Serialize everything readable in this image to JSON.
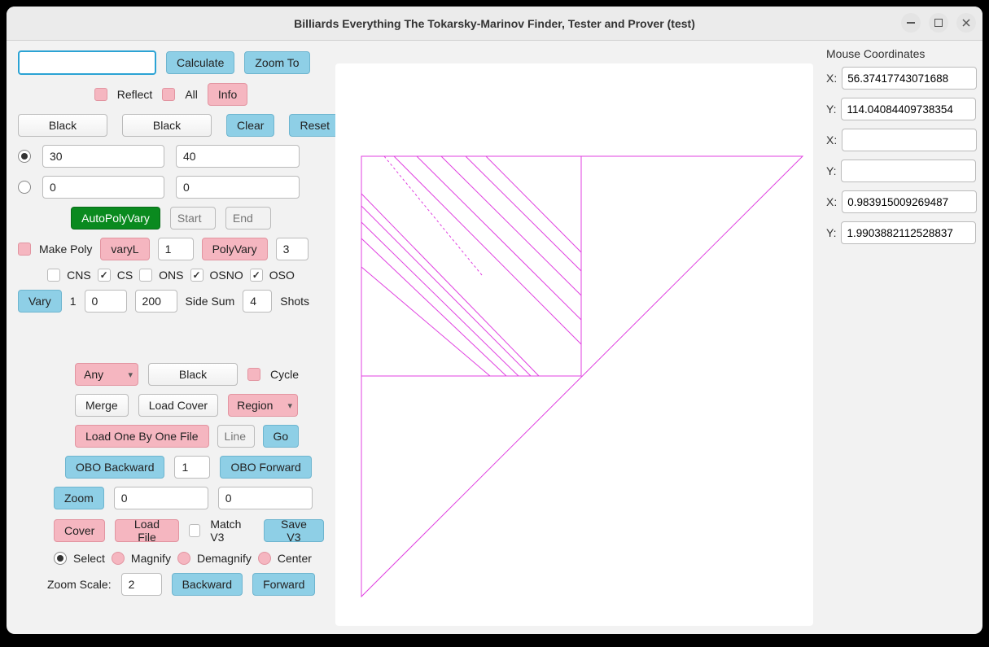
{
  "window": {
    "title": "Billiards Everything The Tokarsky-Marinov Finder, Tester and Prover (test)"
  },
  "top": {
    "calculate": "Calculate",
    "zoom_to": "Zoom To",
    "reflect": "Reflect",
    "all": "All",
    "info": "Info"
  },
  "colors": {
    "black1": "Black",
    "black2": "Black",
    "clear": "Clear",
    "reset": "Reset"
  },
  "angles": {
    "row1a": "30",
    "row1b": "40",
    "row2a": "0",
    "row2b": "0"
  },
  "poly": {
    "autopolyvary": "AutoPolyVary",
    "start_ph": "Start",
    "end_ph": "End",
    "make_poly": "Make Poly",
    "varyL": "varyL",
    "varyL_val": "1",
    "polyvary": "PolyVary",
    "polyvary_val": "3"
  },
  "checks": {
    "cns": "CNS",
    "cs": "CS",
    "ons": "ONS",
    "osno": "OSNO",
    "oso": "OSO"
  },
  "vary": {
    "vary": "Vary",
    "num": "1",
    "val1": "0",
    "val2": "200",
    "side_sum": "Side Sum",
    "side_val": "4",
    "shots": "Shots"
  },
  "region": {
    "any": "Any",
    "black": "Black",
    "cycle": "Cycle",
    "merge": "Merge",
    "load_cover": "Load Cover",
    "region": "Region"
  },
  "obo": {
    "load_file": "Load One By One File",
    "line_ph": "Line",
    "go": "Go",
    "backward": "OBO Backward",
    "val": "1",
    "forward": "OBO Forward"
  },
  "zoom": {
    "zoom": "Zoom",
    "v1": "0",
    "v2": "0",
    "cover": "Cover",
    "load_file": "Load File",
    "match_v3": "Match V3",
    "save_v3": "Save V3",
    "select": "Select",
    "magnify": "Magnify",
    "demagnify": "Demagnify",
    "center": "Center",
    "zoom_scale_lbl": "Zoom Scale:",
    "zoom_scale_val": "2",
    "backward": "Backward",
    "forward": "Forward"
  },
  "coords": {
    "title": "Mouse Coordinates",
    "x1": "56.37417743071688",
    "y1": "114.04084409738354",
    "x2": "",
    "y2": "",
    "x3": "0.983915009269487",
    "y3": "1.9903882112528837"
  }
}
